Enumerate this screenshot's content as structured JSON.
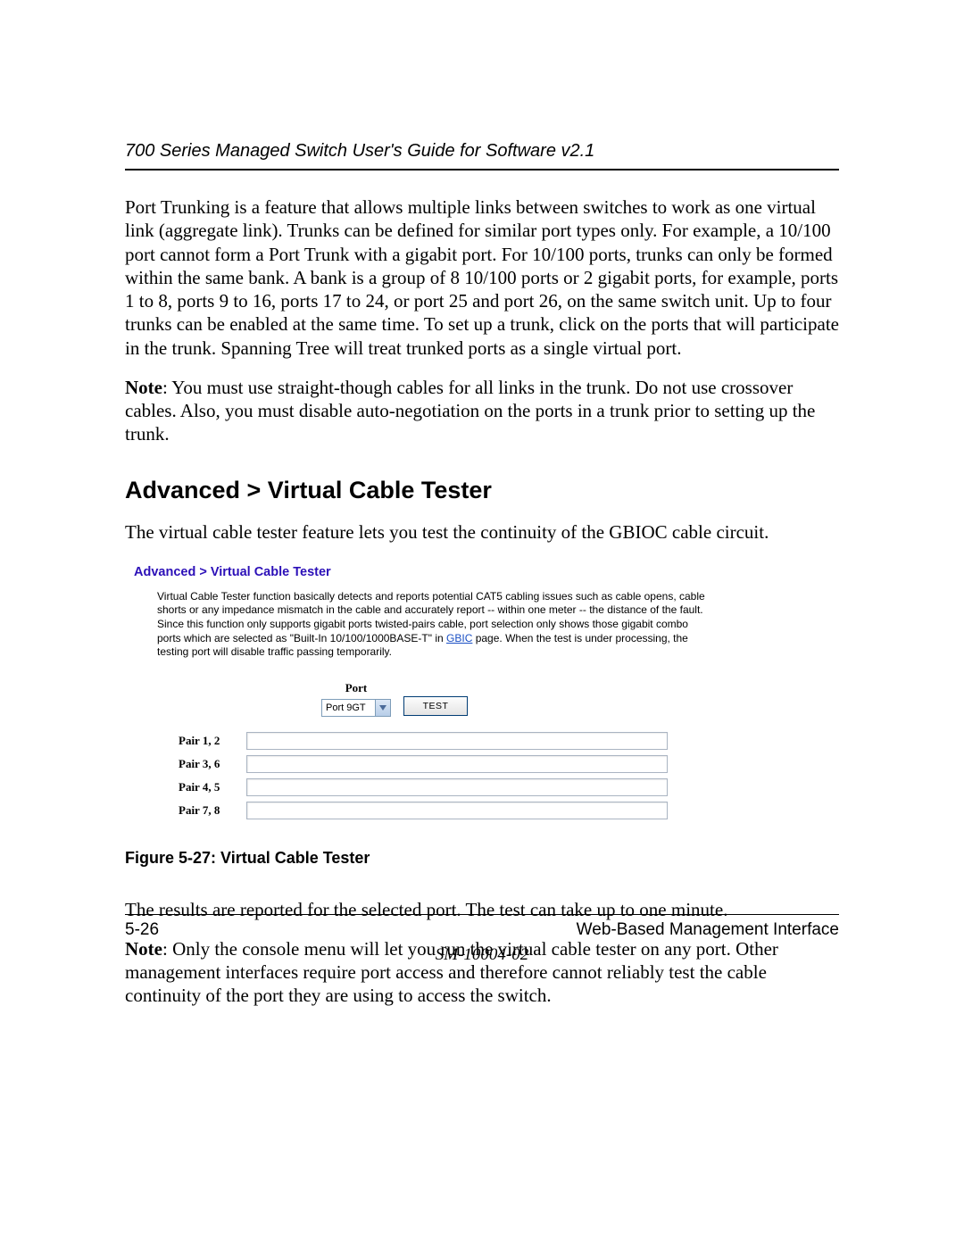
{
  "header": {
    "running_title": "700 Series Managed Switch User's Guide for Software v2.1"
  },
  "body": {
    "p1": "Port Trunking is a feature that allows multiple links between switches to work as one virtual link (aggregate link). Trunks can be defined for similar port types only. For example, a 10/100 port cannot form a Port Trunk with a gigabit port. For 10/100 ports, trunks can only be formed within the same bank. A bank is a group of 8 10/100 ports or 2 gigabit ports, for example, ports 1 to 8, ports 9 to 16, ports 17 to 24, or port 25 and port 26, on the same switch unit.  Up to four trunks can be enabled at the same time.  To set up a trunk, click on the ports that will participate in the trunk. Spanning Tree will treat trunked ports as a single virtual port.",
    "note1_label": "Note",
    "note1_text": ": You must use straight-though cables for all links in the trunk. Do not use crossover cables. Also, you must disable auto-negotiation on the ports in a trunk prior to setting up the trunk.",
    "section_heading": "Advanced > Virtual Cable Tester",
    "p2": "The virtual cable tester feature lets you test the continuity of the GBIOC cable circuit.",
    "p3": "The results are reported for the selected port. The test can take up to one minute.",
    "note2_label": "Note",
    "note2_text": ": Only the console menu will let you run the virtual cable tester on any port. Other management interfaces require port access and therefore cannot reliably test the cable continuity of the port they are using to access the switch."
  },
  "figure": {
    "breadcrumb": "Advanced > Virtual Cable Tester",
    "desc_a": "Virtual Cable Tester function basically detects and reports potential CAT5 cabling issues such as cable opens, cable shorts or any impedance mismatch in the cable and accurately report -- within one meter -- the distance of the fault. Since this function only supports gigabit ports twisted-pairs cable, port selection only shows those gigabit combo ports which are selected as \"Built-In 10/100/1000BASE-T\" in ",
    "gbic_link": "GBIC",
    "desc_b": " page. When the test is under processing, the testing port will disable traffic passing temporarily.",
    "port_label": "Port",
    "port_value": "Port 9GT",
    "test_label": "TEST",
    "pairs": [
      {
        "label": "Pair 1, 2",
        "value": ""
      },
      {
        "label": "Pair 3, 6",
        "value": ""
      },
      {
        "label": "Pair 4, 5",
        "value": ""
      },
      {
        "label": "Pair 7, 8",
        "value": ""
      }
    ],
    "caption": "Figure 5-27:  Virtual Cable Tester"
  },
  "footer": {
    "page_num": "5-26",
    "section": "Web-Based Management Interface",
    "doc_id": "SM-10004-02"
  }
}
